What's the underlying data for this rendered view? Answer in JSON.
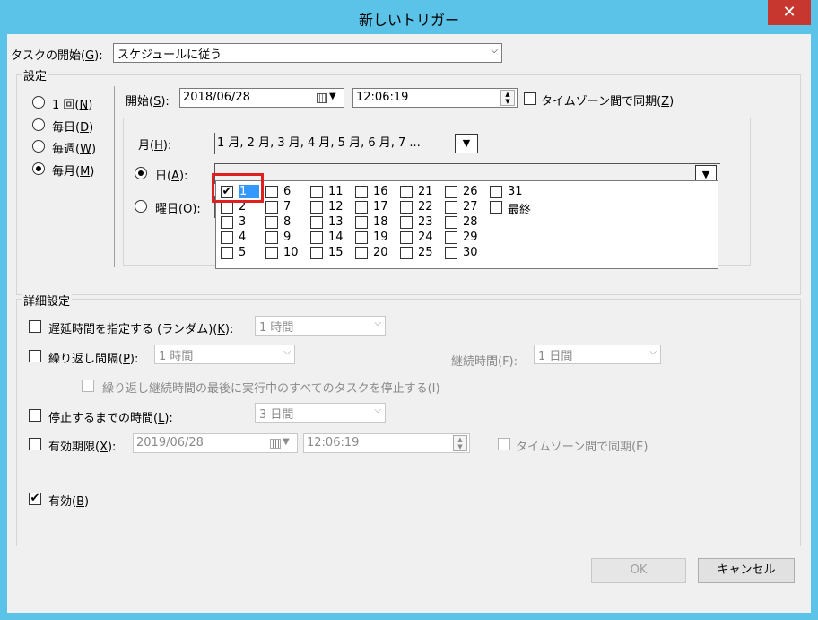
{
  "window": {
    "title": "新しいトリガー",
    "close_glyph": "✕"
  },
  "begin": {
    "label": "タスクの開始(",
    "key": "G",
    "label_end": "):",
    "value": "スケジュールに従う"
  },
  "settings": {
    "group_title": "設定",
    "radios": [
      {
        "label": "1 回(",
        "key": "N",
        "end": ")",
        "checked": false
      },
      {
        "label": "毎日(",
        "key": "D",
        "end": ")",
        "checked": false
      },
      {
        "label": "毎週(",
        "key": "W",
        "end": ")",
        "checked": false
      },
      {
        "label": "毎月(",
        "key": "M",
        "end": ")",
        "checked": true
      }
    ],
    "start_label": "開始(",
    "start_key": "S",
    "start_end": "):",
    "start_date": "2018/06/28",
    "start_time": "12:06:19",
    "sync_tz_label": "タイムゾーン間で同期(",
    "sync_tz_key": "Z",
    "sync_tz_end": ")",
    "month_label": "月(",
    "month_key": "H",
    "month_end": "):",
    "months_value": "1 月, 2 月, 3 月, 4 月, 5 月, 6 月, 7 ...",
    "day_label": "日(",
    "day_key": "A",
    "day_end": "):",
    "weekday_label": "曜日(",
    "weekday_key": "O",
    "weekday_end": "):"
  },
  "days": [
    [
      "1",
      "2",
      "3",
      "4",
      "5"
    ],
    [
      "6",
      "7",
      "8",
      "9",
      "10"
    ],
    [
      "11",
      "12",
      "13",
      "14",
      "15"
    ],
    [
      "16",
      "17",
      "18",
      "19",
      "20"
    ],
    [
      "21",
      "22",
      "23",
      "24",
      "25"
    ],
    [
      "26",
      "27",
      "28",
      "29",
      "30"
    ],
    [
      "31",
      "最終"
    ]
  ],
  "days_checked": [
    "1"
  ],
  "advanced": {
    "group_title": "詳細設定",
    "delay_label": "遅延時間を指定する (ランダム)(",
    "delay_key": "K",
    "delay_end": "):",
    "delay_value": "1 時間",
    "repeat_label": "繰り返し間隔(",
    "repeat_key": "P",
    "repeat_end": "):",
    "repeat_value": "1 時間",
    "duration_label": "継続時間(F):",
    "duration_value": "1 日間",
    "stop_running_label": "繰り返し継続時間の最後に実行中のすべてのタスクを停止する(I)",
    "stop_after_label": "停止するまでの時間(",
    "stop_after_key": "L",
    "stop_after_end": "):",
    "stop_after_value": "3 日間",
    "expire_label": "有効期限(",
    "expire_key": "X",
    "expire_end": "):",
    "expire_date": "2019/06/28",
    "expire_time": "12:06:19",
    "expire_sync_label": "タイムゾーン間で同期(E)",
    "enabled_label": "有効(",
    "enabled_key": "B",
    "enabled_end": ")",
    "enabled": true
  },
  "buttons": {
    "ok": "OK",
    "cancel": "キャンセル"
  },
  "glyphs": {
    "check": "✔",
    "dropdown": "▼",
    "chevron": "⌵",
    "spin_up": "▲",
    "spin_down": "▼"
  }
}
